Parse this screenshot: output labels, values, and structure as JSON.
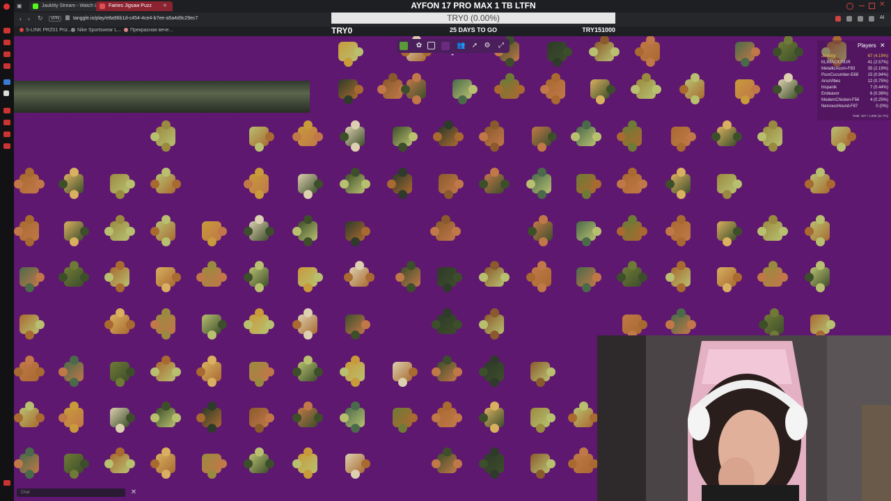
{
  "browser": {
    "tabs": [
      {
        "label": "Jaukitty Stream - Watch Li",
        "color": "#53fc18",
        "active": false
      },
      {
        "label": "Fairies Jigsaw Puzz",
        "color": "#e05050",
        "active": true
      }
    ],
    "new_tab_label": "+",
    "vpn_label": "VPN",
    "url": "tanggle.io/play/e8a96b1d-c454-4ce4-b7ee-a5a4d9c29ec7",
    "bookmarks": [
      "S-LINK PRZ01 Priz...",
      "Nike Sportswear L...",
      "Прекрасная вече..."
    ]
  },
  "goal": {
    "title": "AYFON 17 PRO MAX 1 TB LTFN",
    "progress_text": "TRY0 (0.00%)",
    "progress": 0.0,
    "start": "TRY0",
    "days_left": "25 DAYS TO GO",
    "target": "TRY151000"
  },
  "toolbar": {
    "icons": [
      "puzzle-preview-icon",
      "piece-shape-icon",
      "image-icon",
      "background-color-icon",
      "players-icon",
      "share-icon",
      "settings-icon",
      "fullscreen-icon"
    ],
    "collapse_icon": "chevron-up-icon"
  },
  "players_panel": {
    "title": "Players",
    "close": "✕",
    "players": [
      {
        "name": "Jaukitty",
        "score": "67 (4.19%)",
        "color": "#f0c84a"
      },
      {
        "name": "KLIMACIONUR",
        "score": "41 (2.57%)",
        "color": "#e6e6e6"
      },
      {
        "name": "MetallicAcorn-F83",
        "score": "35 (2.19%)",
        "color": "#e6e6e6"
      },
      {
        "name": "PoorCucumber-E88",
        "score": "15 (0.94%)",
        "color": "#e6e6e6"
      },
      {
        "name": "ArsoVibes",
        "score": "12 (0.75%)",
        "color": "#e6e6e6"
      },
      {
        "name": "hispanik",
        "score": "7 (0.44%)",
        "color": "#e6e6e6"
      },
      {
        "name": "Endeavor",
        "score": "6 (0.38%)",
        "color": "#e6e6e6"
      },
      {
        "name": "ModernChicken-F56",
        "score": "4 (0.25%)",
        "color": "#e6e6e6"
      },
      {
        "name": "NervousHound-F87",
        "score": "0 (0%)",
        "color": "#e6e6e6"
      }
    ],
    "total": "Total: 187 / 1,596 (11.7%)"
  },
  "chat": {
    "placeholder": "Chat",
    "close": "✕"
  },
  "colors": {
    "board_background": "#5e1870",
    "piece_palette": [
      "#c89a3a",
      "#6f7a36",
      "#3d4e2a",
      "#d8b060",
      "#8a5a2c",
      "#b8c070",
      "#4a6a4a",
      "#dcd0b0",
      "#a86a30",
      "#2e3a2a",
      "#9a8a40",
      "#c07848"
    ]
  }
}
